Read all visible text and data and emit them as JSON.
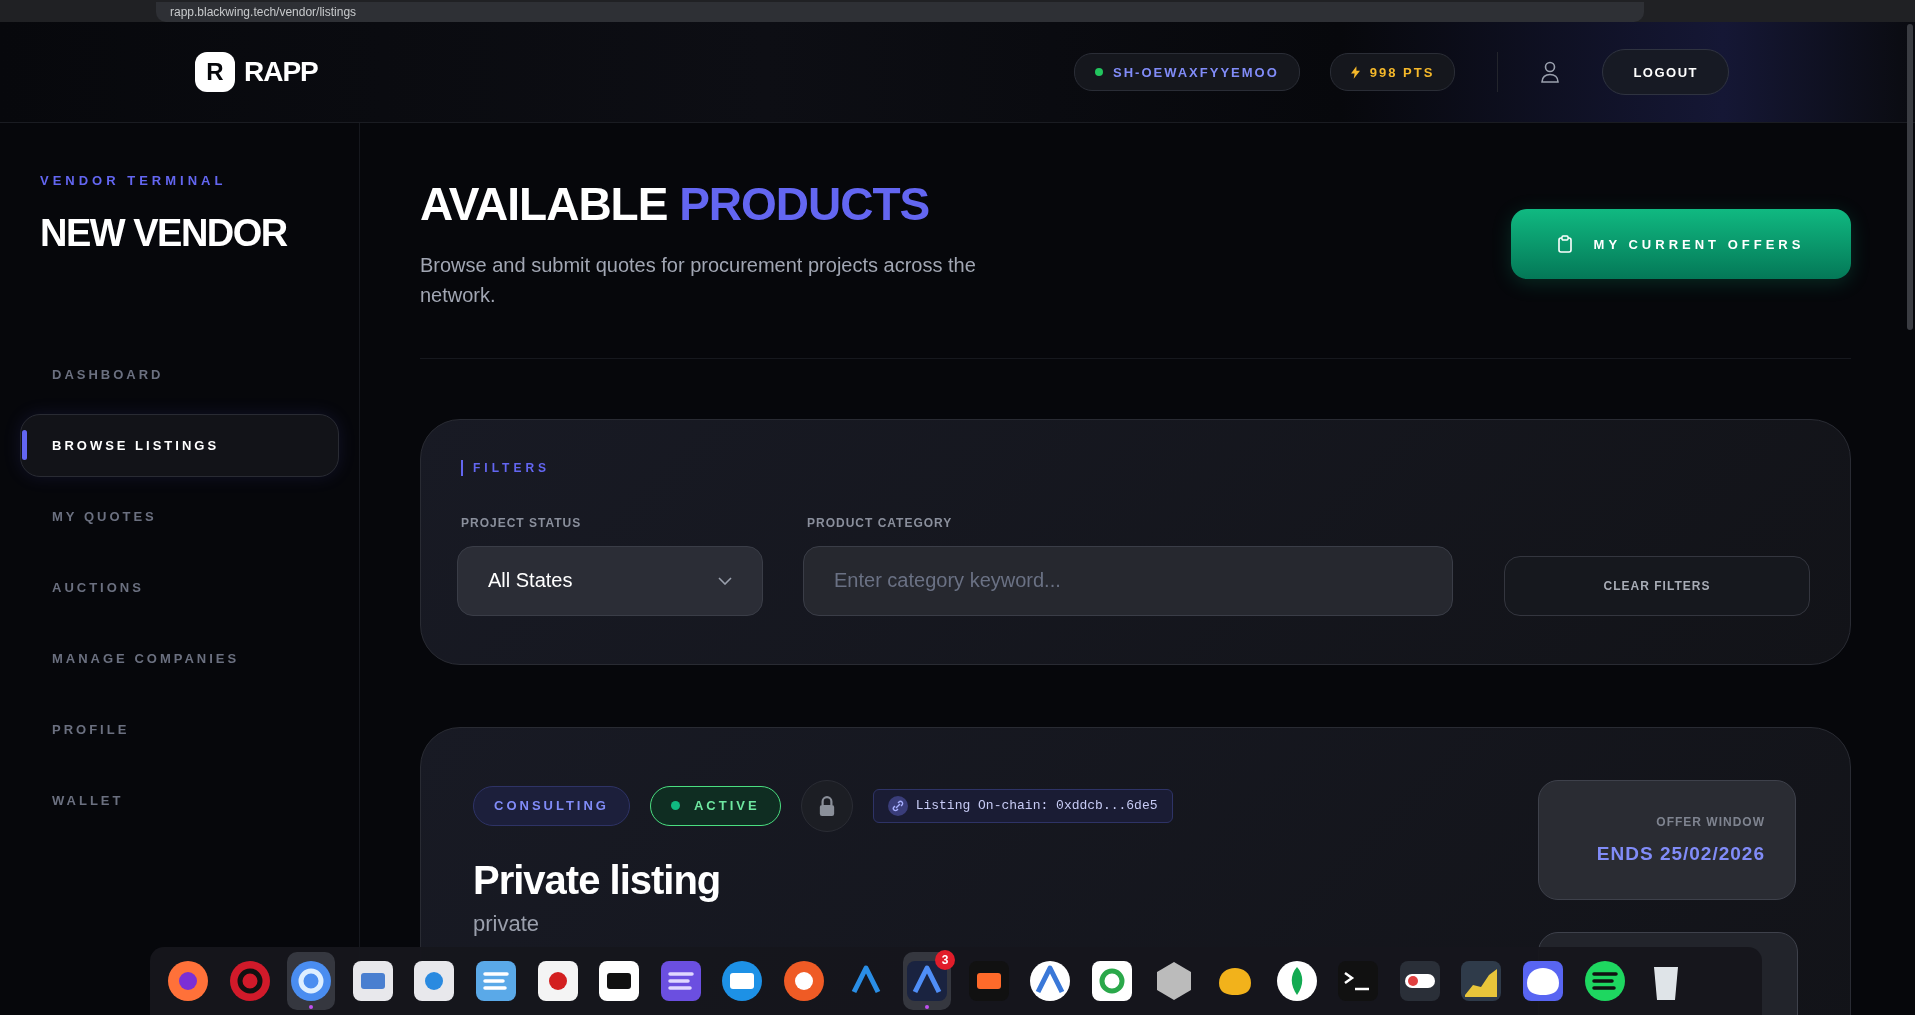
{
  "browser": {
    "url": "rapp.blackwing.tech/vendor/listings"
  },
  "header": {
    "logo_mark": "R",
    "logo_text": "RAPP",
    "session_id": "SH-OEWAXFYYEMOO",
    "online": true,
    "points": "998 PTS",
    "logout": "LOGOUT"
  },
  "sidebar": {
    "eyebrow": "VENDOR TERMINAL",
    "title": "NEW VENDOR",
    "items": [
      {
        "label": "DASHBOARD",
        "selected": false
      },
      {
        "label": "BROWSE LISTINGS",
        "selected": true
      },
      {
        "label": "MY QUOTES",
        "selected": false
      },
      {
        "label": "AUCTIONS",
        "selected": false
      },
      {
        "label": "MANAGE COMPANIES",
        "selected": false
      },
      {
        "label": "PROFILE",
        "selected": false
      },
      {
        "label": "WALLET",
        "selected": false
      }
    ]
  },
  "page": {
    "title": "AVAILABLE",
    "title_accent": "PRODUCTS",
    "subtitle": "Browse and submit quotes for procurement projects across the network.",
    "action": "MY CURRENT OFFERS"
  },
  "filters": {
    "heading": "FILTERS",
    "status": {
      "label": "PROJECT STATUS",
      "value": "All States"
    },
    "category": {
      "label": "PRODUCT CATEGORY",
      "placeholder": "Enter category keyword..."
    },
    "clear": "CLEAR FILTERS"
  },
  "listing": {
    "category": "CONSULTING",
    "status": "ACTIVE",
    "active": true,
    "locked": true,
    "chain": "Listing On-chain: 0xddcb...6de5",
    "title": "Private listing",
    "description": "private",
    "offer_window": {
      "label": "OFFER WINDOW",
      "value": "ENDS 25/02/2026"
    }
  },
  "dock": {
    "apps": [
      {
        "running": false
      },
      {
        "running": false
      },
      {
        "running": true
      },
      {
        "running": false
      },
      {
        "running": false
      },
      {
        "running": false
      },
      {
        "running": false
      },
      {
        "running": false
      },
      {
        "running": false
      },
      {
        "running": false
      },
      {
        "running": false
      },
      {
        "running": false
      },
      {
        "running": true,
        "badge": "3"
      },
      {
        "running": false
      },
      {
        "running": false
      },
      {
        "running": false
      },
      {
        "running": false
      },
      {
        "running": false
      },
      {
        "running": false
      },
      {
        "running": false
      },
      {
        "running": false
      },
      {
        "running": false
      },
      {
        "running": false
      },
      {
        "running": false
      },
      {
        "running": false
      }
    ]
  }
}
